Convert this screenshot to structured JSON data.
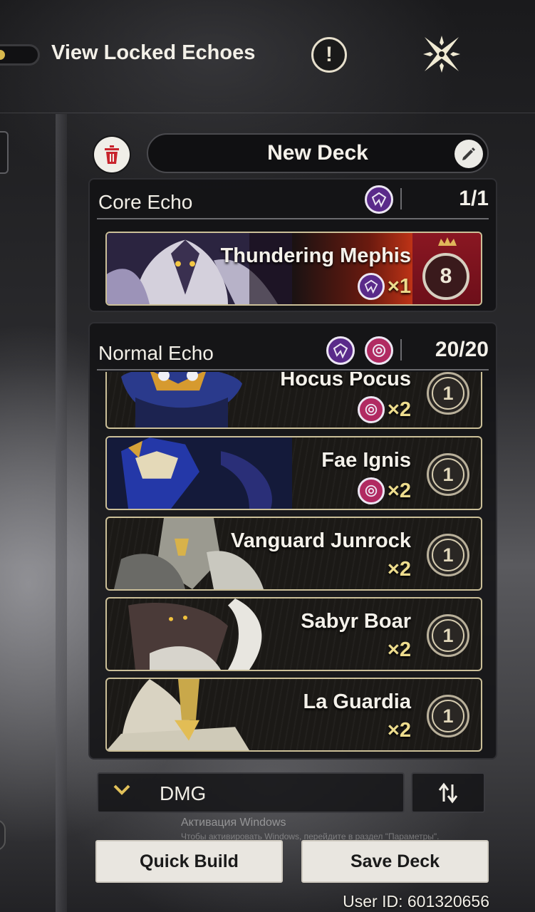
{
  "header": {
    "locked_toggle_label": "View Locked Echoes",
    "info_icon": "!",
    "close_icon": "close-x-icon"
  },
  "deck": {
    "name": "New Deck"
  },
  "core_section": {
    "title": "Core Echo",
    "count": "1/1",
    "card": {
      "name": "Thundering Mephis",
      "multiplier": "×1",
      "cost": "8",
      "type": "purple"
    }
  },
  "normal_section": {
    "title": "Normal Echo",
    "count": "20/20",
    "cards": [
      {
        "name": "Hocus Pocus",
        "multiplier": "×2",
        "cost": "1",
        "type": "pink"
      },
      {
        "name": "Fae Ignis",
        "multiplier": "×2",
        "cost": "1",
        "type": "pink"
      },
      {
        "name": "Vanguard Junrock",
        "multiplier": "×2",
        "cost": "1",
        "type": ""
      },
      {
        "name": "Sabyr Boar",
        "multiplier": "×2",
        "cost": "1",
        "type": ""
      },
      {
        "name": "La Guardia",
        "multiplier": "×2",
        "cost": "1",
        "type": ""
      }
    ]
  },
  "controls": {
    "sort_label": "DMG",
    "quick_build": "Quick Build",
    "save_deck": "Save Deck"
  },
  "watermark": {
    "line1": "Активация Windows",
    "line2": "Чтобы активировать Windows, перейдите в раздел \"Параметры\"."
  },
  "footer": {
    "user_id": "User ID: 601320656"
  },
  "colors": {
    "accent_gold": "#eddc8d",
    "type_purple": "#5a2a8a",
    "type_pink": "#b12a62",
    "core_card_red": "#c42a17"
  }
}
